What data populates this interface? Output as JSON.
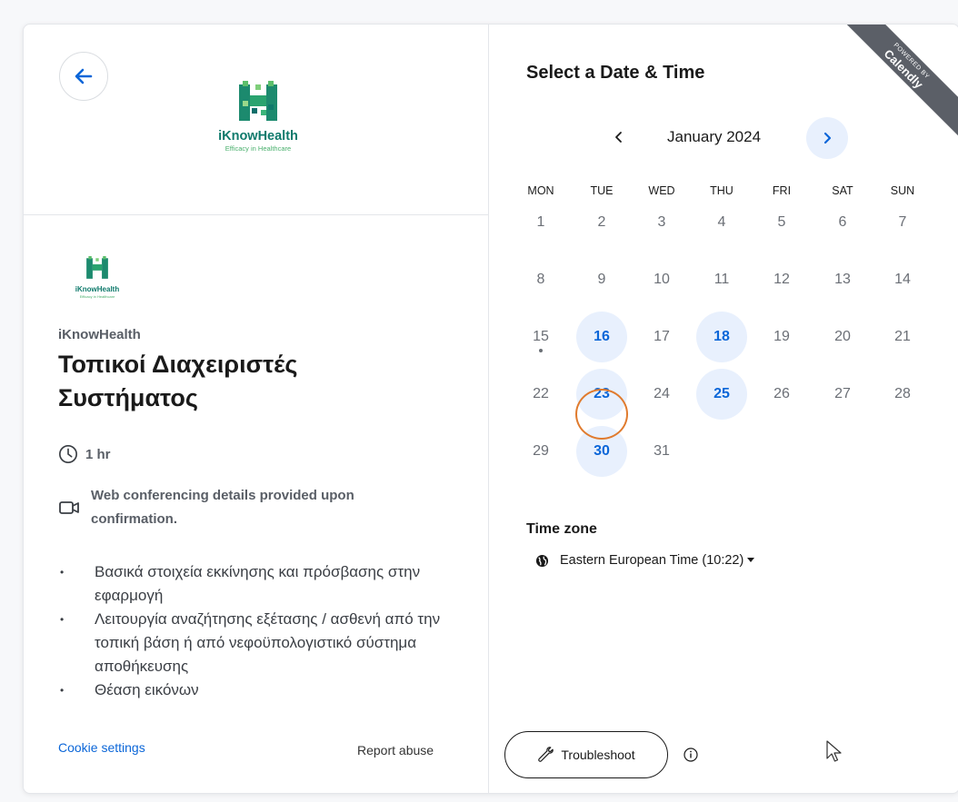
{
  "brand": {
    "name": "iKnowHealth",
    "tagline": "Efficacy in Healthcare",
    "color": "#0f7a6c",
    "tagline_color": "#4ab06d"
  },
  "event": {
    "organizer": "iKnowHealth",
    "title": "Τοπικοί Διαχειριστές Συστήματος",
    "duration": "1 hr",
    "conferencing": "Web conferencing details provided upon confirmation.",
    "agenda": [
      "Βασικά στοιχεία εκκίνησης και πρόσβασης στην εφαρμογή",
      "Λειτουργία αναζήτησης εξέτασης / ασθενή από την τοπική βάση ή από νεφοϋπολογιστικό σύστημα αποθήκευσης",
      "Θέαση εικόνων"
    ]
  },
  "footer": {
    "cookie_settings": "Cookie settings",
    "report_abuse": "Report abuse"
  },
  "scheduler": {
    "title": "Select a Date & Time",
    "month": "January 2024",
    "weekdays": [
      "MON",
      "TUE",
      "WED",
      "THU",
      "FRI",
      "SAT",
      "SUN"
    ],
    "weeks": [
      [
        "1",
        "2",
        "3",
        "4",
        "5",
        "6",
        "7"
      ],
      [
        "8",
        "9",
        "10",
        "11",
        "12",
        "13",
        "14"
      ],
      [
        "15",
        "16",
        "17",
        "18",
        "19",
        "20",
        "21"
      ],
      [
        "22",
        "23",
        "24",
        "25",
        "26",
        "27",
        "28"
      ],
      [
        "29",
        "30",
        "31",
        "",
        "",
        "",
        ""
      ]
    ],
    "available_days": [
      "16",
      "18",
      "23",
      "25",
      "30"
    ],
    "today": "15",
    "highlighted_day": "23",
    "accent_color": "#0b66d8",
    "available_bg": "#e8f0fd"
  },
  "timezone": {
    "label": "Time zone",
    "value": "Eastern European Time (10:22)"
  },
  "ribbon": {
    "line1": "POWERED BY",
    "line2": "Calendly"
  },
  "actions": {
    "troubleshoot": "Troubleshoot"
  },
  "icons": [
    "back-arrow-icon",
    "clock-icon",
    "video-icon",
    "chevron-left-icon",
    "chevron-right-icon",
    "globe-icon",
    "caret-down-icon",
    "wrench-icon",
    "info-icon",
    "mouse-cursor-icon"
  ]
}
